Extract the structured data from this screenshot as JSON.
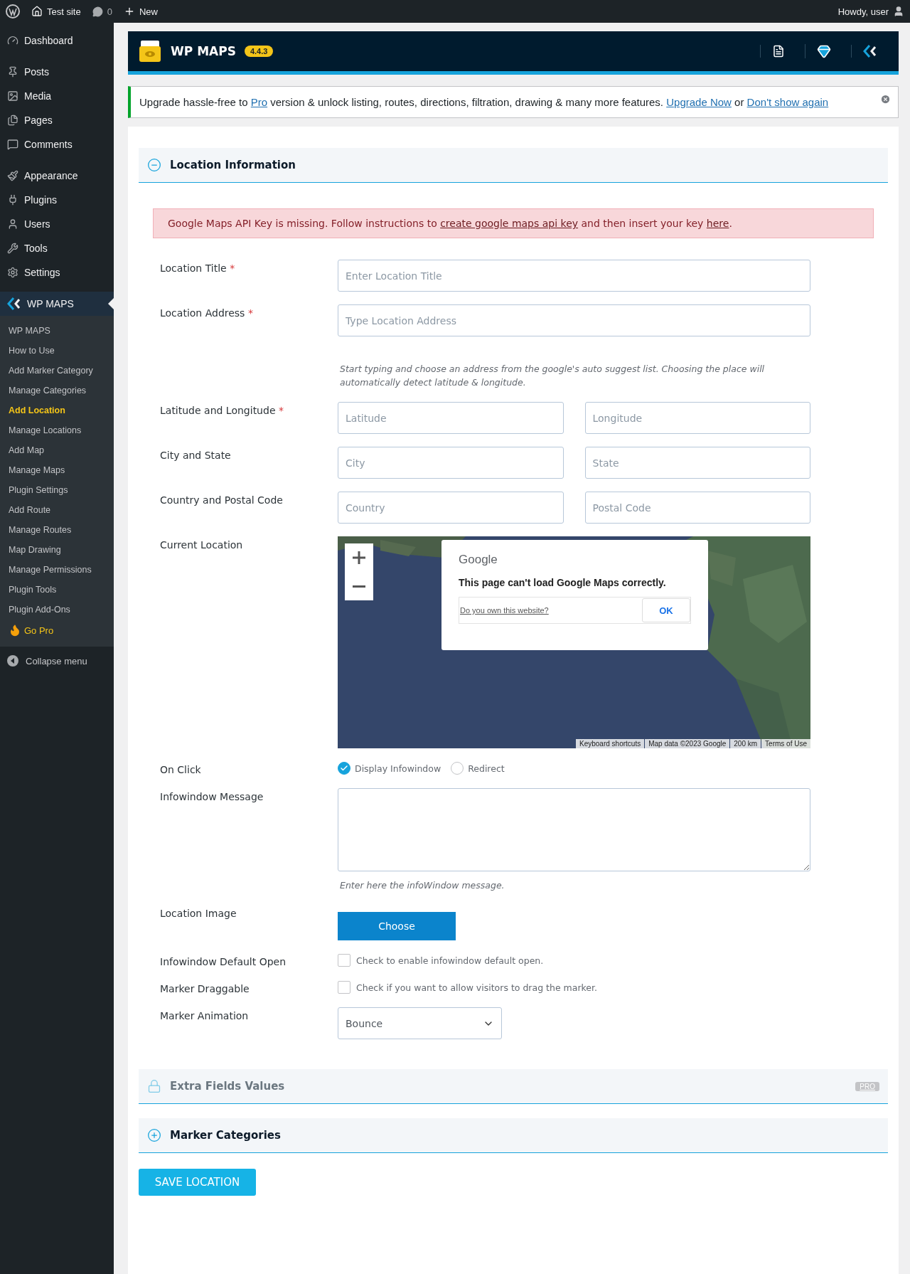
{
  "admin_bar": {
    "site": "Test site",
    "comments": "0",
    "new": "New",
    "greeting": "Howdy, user"
  },
  "sidebar": {
    "items": [
      {
        "label": "Dashboard",
        "kind": "dashboard",
        "selected": false
      },
      {
        "label": "Posts",
        "kind": "posts",
        "selected": false
      },
      {
        "label": "Media",
        "kind": "media",
        "selected": false
      },
      {
        "label": "Pages",
        "kind": "pages",
        "selected": false
      },
      {
        "label": "Comments",
        "kind": "comments",
        "selected": false
      },
      {
        "label": "Appearance",
        "kind": "appearance",
        "selected": false
      },
      {
        "label": "Plugins",
        "kind": "plugins",
        "selected": false
      },
      {
        "label": "Users",
        "kind": "users",
        "selected": false
      },
      {
        "label": "Tools",
        "kind": "tools",
        "selected": false
      },
      {
        "label": "Settings",
        "kind": "settings",
        "selected": false
      },
      {
        "label": "WP MAPS",
        "kind": "wpmaps",
        "selected": true
      }
    ],
    "submenu": [
      {
        "label": "WP MAPS",
        "selected": false
      },
      {
        "label": "How to Use",
        "selected": false
      },
      {
        "label": "Add Marker Category",
        "selected": false
      },
      {
        "label": "Manage Categories",
        "selected": false
      },
      {
        "label": "Add Location",
        "selected": true
      },
      {
        "label": "Manage Locations",
        "selected": false
      },
      {
        "label": "Add Map",
        "selected": false
      },
      {
        "label": "Manage Maps",
        "selected": false
      },
      {
        "label": "Plugin Settings",
        "selected": false
      },
      {
        "label": "Add Route",
        "selected": false
      },
      {
        "label": "Manage Routes",
        "selected": false
      },
      {
        "label": "Map Drawing",
        "selected": false
      },
      {
        "label": "Manage Permissions",
        "selected": false
      },
      {
        "label": "Plugin Tools",
        "selected": false
      },
      {
        "label": "Plugin Add-Ons",
        "selected": false
      }
    ],
    "go_pro": "Go Pro",
    "collapse": "Collapse menu"
  },
  "header": {
    "title": "WP MAPS",
    "version": "4.4.3"
  },
  "notice": [
    {
      "kind": "text",
      "text": "Upgrade hassle-free to "
    },
    {
      "kind": "link",
      "text": "Pro"
    },
    {
      "kind": "text",
      "text": " version & unlock listing, routes, directions, filtration, drawing & many more features. "
    },
    {
      "kind": "link",
      "text": "Upgrade Now"
    },
    {
      "kind": "text",
      "text": " or "
    },
    {
      "kind": "link",
      "text": "Don't show again"
    }
  ],
  "location_section": {
    "title": "Location Information",
    "expanded": true
  },
  "alert": [
    {
      "kind": "text",
      "text": "Google Maps API Key is missing. Follow instructions to "
    },
    {
      "kind": "link",
      "text": "create google maps api key"
    },
    {
      "kind": "text",
      "text": " and then insert your key "
    },
    {
      "kind": "link",
      "text": "here"
    },
    {
      "kind": "text",
      "text": "."
    }
  ],
  "fields": [
    {
      "kind": "text",
      "label": "Location Title",
      "required_mark": "*",
      "inputs": [
        {
          "placeholder": "Enter Location Title"
        }
      ]
    },
    {
      "kind": "text",
      "label": "Location Address",
      "required_mark": "*",
      "inputs": [
        {
          "placeholder": "Type Location Address"
        }
      ],
      "help": "Start typing and choose an address from the google's auto suggest list. Choosing the place will automatically detect latitude & longitude."
    },
    {
      "kind": "text",
      "label": "Latitude and Longitude",
      "required_mark": "*",
      "inputs": [
        {
          "placeholder": "Latitude"
        },
        {
          "placeholder": "Longitude"
        }
      ]
    },
    {
      "kind": "text",
      "label": "City and State",
      "inputs": [
        {
          "placeholder": "City"
        },
        {
          "placeholder": "State"
        }
      ]
    },
    {
      "kind": "text",
      "label": "Country and Postal Code",
      "inputs": [
        {
          "placeholder": "Country"
        },
        {
          "placeholder": "Postal Code"
        }
      ]
    },
    {
      "kind": "map",
      "label": "Current Location",
      "dialog": {
        "brand": "Google",
        "message": "This page can't load Google Maps correctly.",
        "link": "Do you own this website?",
        "button": "OK"
      },
      "attribution": [
        "Keyboard shortcuts",
        "Map data ©2023 Google",
        "200 km",
        "Terms of Use"
      ]
    },
    {
      "kind": "radio",
      "label": "On Click",
      "options": [
        {
          "label": "Display Infowindow",
          "selected": true
        },
        {
          "label": "Redirect",
          "selected": false
        }
      ]
    },
    {
      "kind": "textarea",
      "label": "Infowindow Message",
      "help": "Enter here the infoWindow message."
    },
    {
      "kind": "button",
      "label": "Location Image",
      "button": "Choose"
    },
    {
      "kind": "checkbox",
      "label": "Infowindow Default Open",
      "text": "Check to enable infowindow default open.",
      "checked": false
    },
    {
      "kind": "checkbox",
      "label": "Marker Draggable",
      "text": "Check if you want to allow visitors to drag the marker.",
      "checked": false
    },
    {
      "kind": "select",
      "label": "Marker Animation",
      "value": "Bounce"
    }
  ],
  "extra_section": {
    "title": "Extra Fields Values",
    "badge": "PRO"
  },
  "categories_section": {
    "title": "Marker Categories",
    "expanded": false
  },
  "save_button": "SAVE LOCATION"
}
